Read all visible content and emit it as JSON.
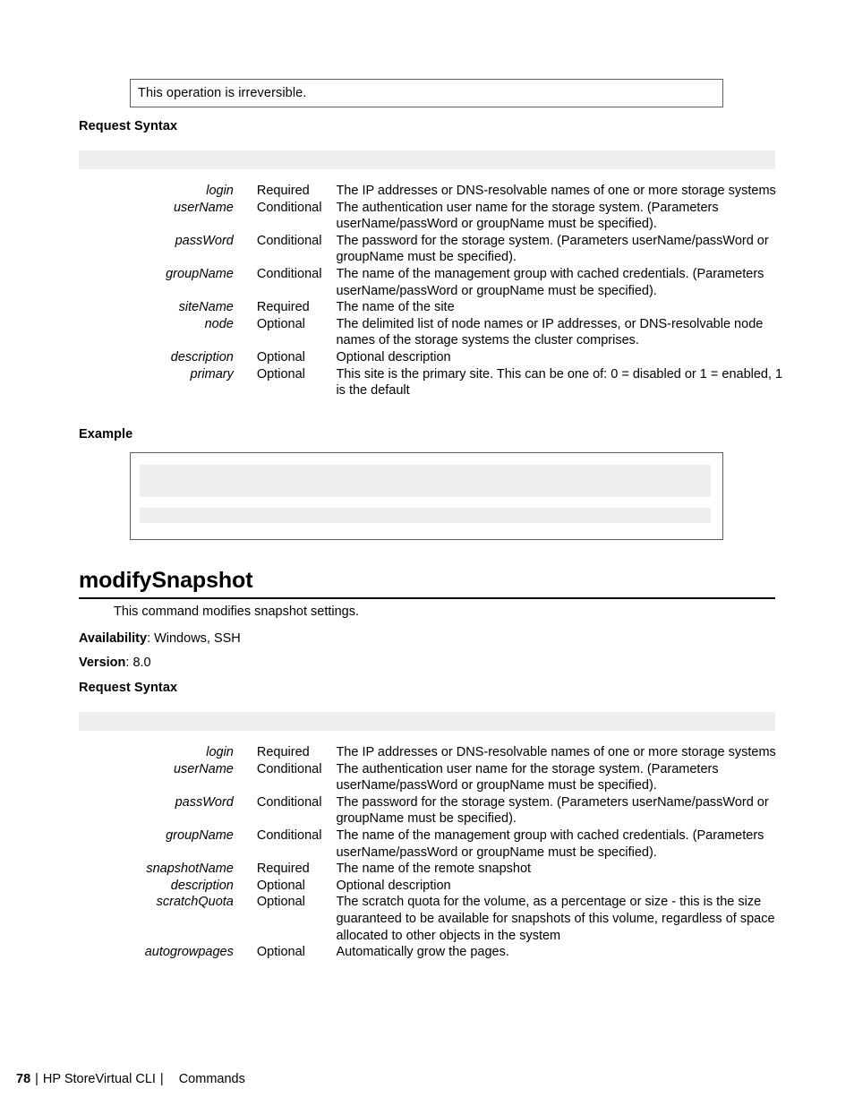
{
  "note": {
    "text": "This operation is irreversible."
  },
  "section1": {
    "request_syntax_label": "Request Syntax",
    "syntax_block": "",
    "parameters": [
      {
        "name": "login",
        "requirement": "Required",
        "description": "The IP addresses or DNS-resolvable names of one or more storage systems"
      },
      {
        "name": "userName",
        "requirement": "Conditional",
        "description": "The authentication user name for the storage system. (Parameters userName/passWord or groupName must be specified)."
      },
      {
        "name": "passWord",
        "requirement": "Conditional",
        "description": "The password for the storage system. (Parameters userName/passWord or groupName must be specified)."
      },
      {
        "name": "groupName",
        "requirement": "Conditional",
        "description": "The name of the management group with cached credentials. (Parameters userName/passWord or groupName must be specified)."
      },
      {
        "name": "siteName",
        "requirement": "Required",
        "description": "The name of the site"
      },
      {
        "name": "node",
        "requirement": "Optional",
        "description": "The delimited list of node names or IP addresses, or DNS-resolvable node names of the storage systems the cluster comprises."
      },
      {
        "name": "description",
        "requirement": "Optional",
        "description": "Optional description"
      },
      {
        "name": "primary",
        "requirement": "Optional",
        "description": "This site is the primary site. This can be one of: 0 = disabled or 1 = enabled, 1 is the default"
      }
    ],
    "example_label": "Example",
    "example_block": ""
  },
  "section2": {
    "command_name": "modifySnapshot",
    "command_description": "This command modifies snapshot settings.",
    "availability_key": "Availability",
    "availability_value": ": Windows, SSH",
    "version_key": "Version",
    "version_value": ": 8.0",
    "request_syntax_label": "Request Syntax",
    "syntax_block": "",
    "parameters": [
      {
        "name": "login",
        "requirement": "Required",
        "description": "The IP addresses or DNS-resolvable names of one or more storage systems"
      },
      {
        "name": "userName",
        "requirement": "Conditional",
        "description": "The authentication user name for the storage system. (Parameters userName/passWord or groupName must be specified)."
      },
      {
        "name": "passWord",
        "requirement": "Conditional",
        "description": "The password for the storage system. (Parameters userName/passWord or groupName must be specified)."
      },
      {
        "name": "groupName",
        "requirement": "Conditional",
        "description": "The name of the management group with cached credentials. (Parameters userName/passWord or groupName must be specified)."
      },
      {
        "name": "snapshotName",
        "requirement": "Required",
        "description": "The name of the remote snapshot"
      },
      {
        "name": "description",
        "requirement": "Optional",
        "description": "Optional description"
      },
      {
        "name": "scratchQuota",
        "requirement": "Optional",
        "description": "The scratch quota for the volume, as a percentage or size - this is the size guaranteed to be available for snapshots of this volume, regardless of space allocated to other objects in the system"
      },
      {
        "name": "autogrowpages",
        "requirement": "Optional",
        "description": "Automatically grow the pages."
      }
    ]
  },
  "footer": {
    "page_number": "78",
    "separator": "|",
    "product": "HP StoreVirtual CLI",
    "separator2": "|",
    "section": "Commands"
  },
  "colors": {
    "syntax_band": "#efefef",
    "box_border": "#5f5f5f",
    "text": "#000000"
  }
}
